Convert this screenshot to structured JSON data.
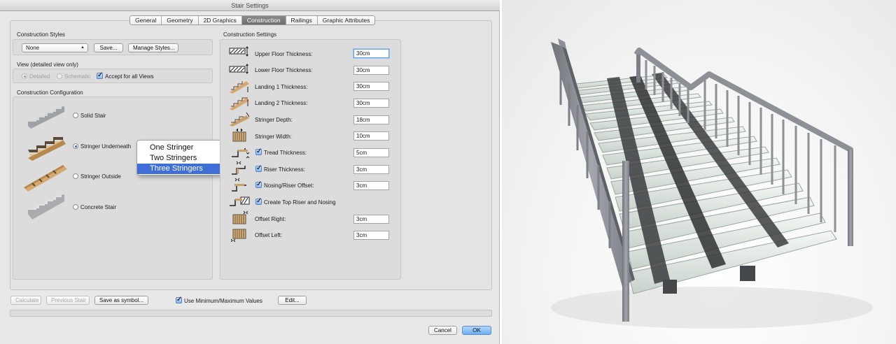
{
  "window": {
    "title": "Stair Settings"
  },
  "tabs": [
    {
      "label": "General",
      "active": false
    },
    {
      "label": "Geometry",
      "active": false
    },
    {
      "label": "2D Graphics",
      "active": false
    },
    {
      "label": "Construction",
      "active": true
    },
    {
      "label": "Railings",
      "active": false
    },
    {
      "label": "Graphic Attributes",
      "active": false
    }
  ],
  "construction_styles": {
    "heading": "Construction Styles",
    "style_value": "None",
    "save_label": "Save...",
    "manage_label": "Manage Styles..."
  },
  "view": {
    "heading": "View (detailed view only)",
    "detailed_label": "Detailed",
    "schematic_label": "Schematic",
    "accept_label": "Accept for all Views"
  },
  "configuration": {
    "heading": "Construction Configuration",
    "options": [
      {
        "label": "Solid Stair",
        "selected": false
      },
      {
        "label": "Stringer Underneath",
        "selected": true
      },
      {
        "label": "Stringer Outside",
        "selected": false
      },
      {
        "label": "Concrete Stair",
        "selected": false
      }
    ]
  },
  "stringer_menu": {
    "items": [
      "One Stringer",
      "Two Stringers",
      "Three Stringers"
    ],
    "selected_index": 2
  },
  "settings": {
    "heading": "Construction Settings",
    "rows": [
      {
        "label": "Upper Floor Thickness:",
        "value": "30cm",
        "checkbox": false
      },
      {
        "label": "Lower Floor Thickness:",
        "value": "30cm",
        "checkbox": false
      },
      {
        "label": "Landing 1 Thickness:",
        "value": "30cm",
        "checkbox": false
      },
      {
        "label": "Landing 2 Thickness:",
        "value": "30cm",
        "checkbox": false
      },
      {
        "label": "Stringer Depth:",
        "value": "18cm",
        "checkbox": false
      },
      {
        "label": "Stringer Width:",
        "value": "10cm",
        "checkbox": false
      },
      {
        "label": "Tread Thickness:",
        "value": "5cm",
        "checkbox": true
      },
      {
        "label": "Riser Thickness:",
        "value": "3cm",
        "checkbox": true
      },
      {
        "label": "Nosing/Riser Offset:",
        "value": "3cm",
        "checkbox": true
      },
      {
        "label": "Create Top Riser and Nosing",
        "value": "",
        "checkbox": true
      },
      {
        "label": "Offset Right:",
        "value": "3cm",
        "checkbox": false
      },
      {
        "label": "Offset Left:",
        "value": "3cm",
        "checkbox": false
      }
    ]
  },
  "footer": {
    "calculate_label": "Calculate",
    "previous_label": "Previous Stair",
    "save_symbol_label": "Save as symbol...",
    "minmax_label": "Use Minimum/Maximum Values",
    "edit_label": "Edit...",
    "cancel_label": "Cancel",
    "ok_label": "OK"
  },
  "colors": {
    "accent": "#3f6fd6",
    "ok_button": "#6aaef3",
    "wood": "#c9a06a",
    "steel": "#8d9096",
    "glass": "#dfe8e2"
  },
  "icons": {
    "solid_stair": "solid-stair-icon",
    "stringer_underneath": "stringer-underneath-icon",
    "stringer_outside": "stringer-outside-icon",
    "concrete_stair": "concrete-stair-icon"
  }
}
